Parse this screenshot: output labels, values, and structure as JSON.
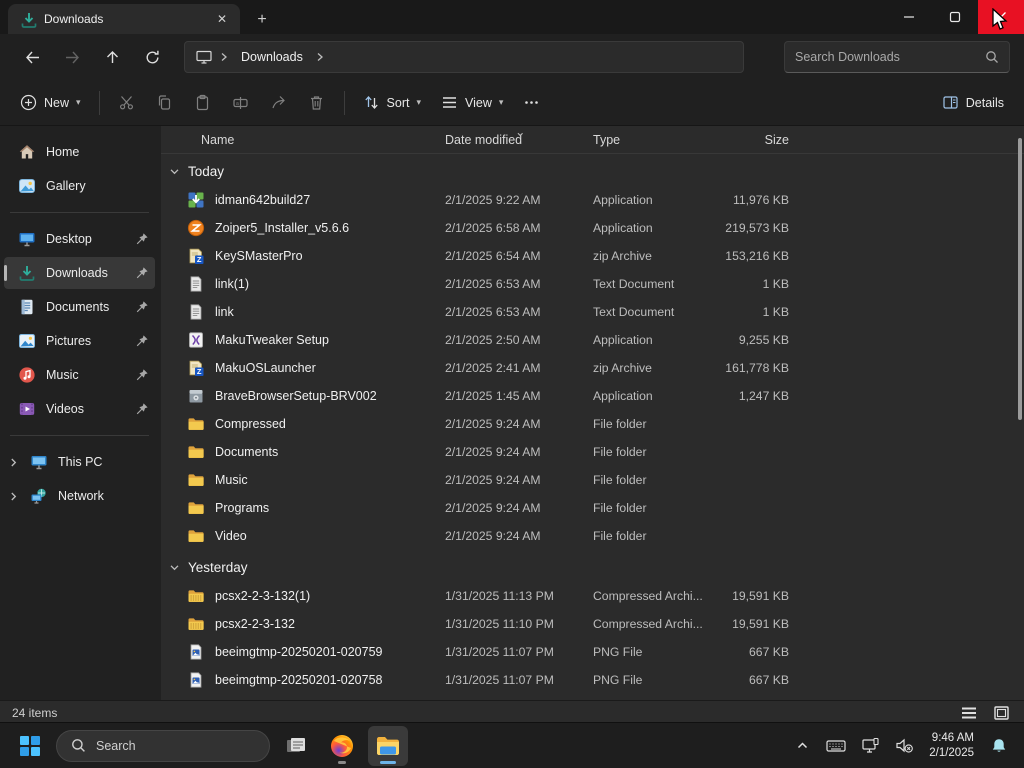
{
  "window": {
    "tab": {
      "title": "Downloads",
      "icon": "downloads"
    },
    "nav": {
      "breadcrumb_root_icon": "this-pc",
      "breadcrumb_label": "Downloads",
      "search_placeholder": "Search Downloads"
    },
    "toolbar": {
      "new_label": "New",
      "sort_label": "Sort",
      "view_label": "View",
      "details_label": "Details"
    },
    "columns": {
      "name": "Name",
      "date": "Date modified",
      "type": "Type",
      "size": "Size"
    },
    "sidebar": {
      "top": [
        {
          "label": "Home",
          "icon": "home"
        },
        {
          "label": "Gallery",
          "icon": "gallery"
        }
      ],
      "pinned": [
        {
          "label": "Desktop",
          "icon": "desktop",
          "pinned": true
        },
        {
          "label": "Downloads",
          "icon": "downloads",
          "pinned": true,
          "selected": true
        },
        {
          "label": "Documents",
          "icon": "documents",
          "pinned": true
        },
        {
          "label": "Pictures",
          "icon": "pictures",
          "pinned": true
        },
        {
          "label": "Music",
          "icon": "music",
          "pinned": true
        },
        {
          "label": "Videos",
          "icon": "videos",
          "pinned": true
        }
      ],
      "tree": [
        {
          "label": "This PC",
          "icon": "this-pc"
        },
        {
          "label": "Network",
          "icon": "network"
        }
      ]
    },
    "groups": [
      {
        "label": "Today",
        "rows": [
          {
            "icon": "app-idman",
            "name": "idman642build27",
            "date": "2/1/2025 9:22 AM",
            "type": "Application",
            "size": "11,976 KB"
          },
          {
            "icon": "app-zoiper",
            "name": "Zoiper5_Installer_v5.6.6",
            "date": "2/1/2025 6:58 AM",
            "type": "Application",
            "size": "219,573 KB"
          },
          {
            "icon": "zip",
            "name": "KeySMasterPro",
            "date": "2/1/2025 6:54 AM",
            "type": "zip Archive",
            "size": "153,216 KB"
          },
          {
            "icon": "text",
            "name": "link(1)",
            "date": "2/1/2025 6:53 AM",
            "type": "Text Document",
            "size": "1 KB"
          },
          {
            "icon": "text",
            "name": "link",
            "date": "2/1/2025 6:53 AM",
            "type": "Text Document",
            "size": "1 KB"
          },
          {
            "icon": "app-maku",
            "name": "MakuTweaker Setup",
            "date": "2/1/2025 2:50 AM",
            "type": "Application",
            "size": "9,255 KB"
          },
          {
            "icon": "zip",
            "name": "MakuOSLauncher",
            "date": "2/1/2025 2:41 AM",
            "type": "zip Archive",
            "size": "161,778 KB"
          },
          {
            "icon": "app-setup",
            "name": "BraveBrowserSetup-BRV002",
            "date": "2/1/2025 1:45 AM",
            "type": "Application",
            "size": "1,247 KB"
          },
          {
            "icon": "folder",
            "name": "Compressed",
            "date": "2/1/2025 9:24 AM",
            "type": "File folder",
            "size": ""
          },
          {
            "icon": "folder",
            "name": "Documents",
            "date": "2/1/2025 9:24 AM",
            "type": "File folder",
            "size": ""
          },
          {
            "icon": "folder",
            "name": "Music",
            "date": "2/1/2025 9:24 AM",
            "type": "File folder",
            "size": ""
          },
          {
            "icon": "folder",
            "name": "Programs",
            "date": "2/1/2025 9:24 AM",
            "type": "File folder",
            "size": ""
          },
          {
            "icon": "folder",
            "name": "Video",
            "date": "2/1/2025 9:24 AM",
            "type": "File folder",
            "size": ""
          }
        ]
      },
      {
        "label": "Yesterday",
        "rows": [
          {
            "icon": "folder-zip",
            "name": "pcsx2-2-3-132(1)",
            "date": "1/31/2025 11:13 PM",
            "type": "Compressed Archi...",
            "size": "19,591 KB"
          },
          {
            "icon": "folder-zip",
            "name": "pcsx2-2-3-132",
            "date": "1/31/2025 11:10 PM",
            "type": "Compressed Archi...",
            "size": "19,591 KB"
          },
          {
            "icon": "png",
            "name": "beeimgtmp-20250201-020759",
            "date": "1/31/2025 11:07 PM",
            "type": "PNG File",
            "size": "667 KB"
          },
          {
            "icon": "png",
            "name": "beeimgtmp-20250201-020758",
            "date": "1/31/2025 11:07 PM",
            "type": "PNG File",
            "size": "667 KB"
          },
          {
            "icon": "folder-zip",
            "name": "",
            "date": "",
            "type": "",
            "size": "",
            "partial": true
          }
        ]
      }
    ],
    "status": {
      "items_count": "24 items"
    }
  },
  "taskbar": {
    "search_placeholder": "Search",
    "clock": {
      "time": "9:46 AM",
      "date": "2/1/2025"
    }
  },
  "colors": {
    "close_button_red": "#e81123",
    "folder_yellow": "#f3c94e",
    "downloads_teal": "#2fae9b",
    "active_indicator_blue": "#6db3e8",
    "notification_bell_cyan": "#a9e4f0"
  }
}
